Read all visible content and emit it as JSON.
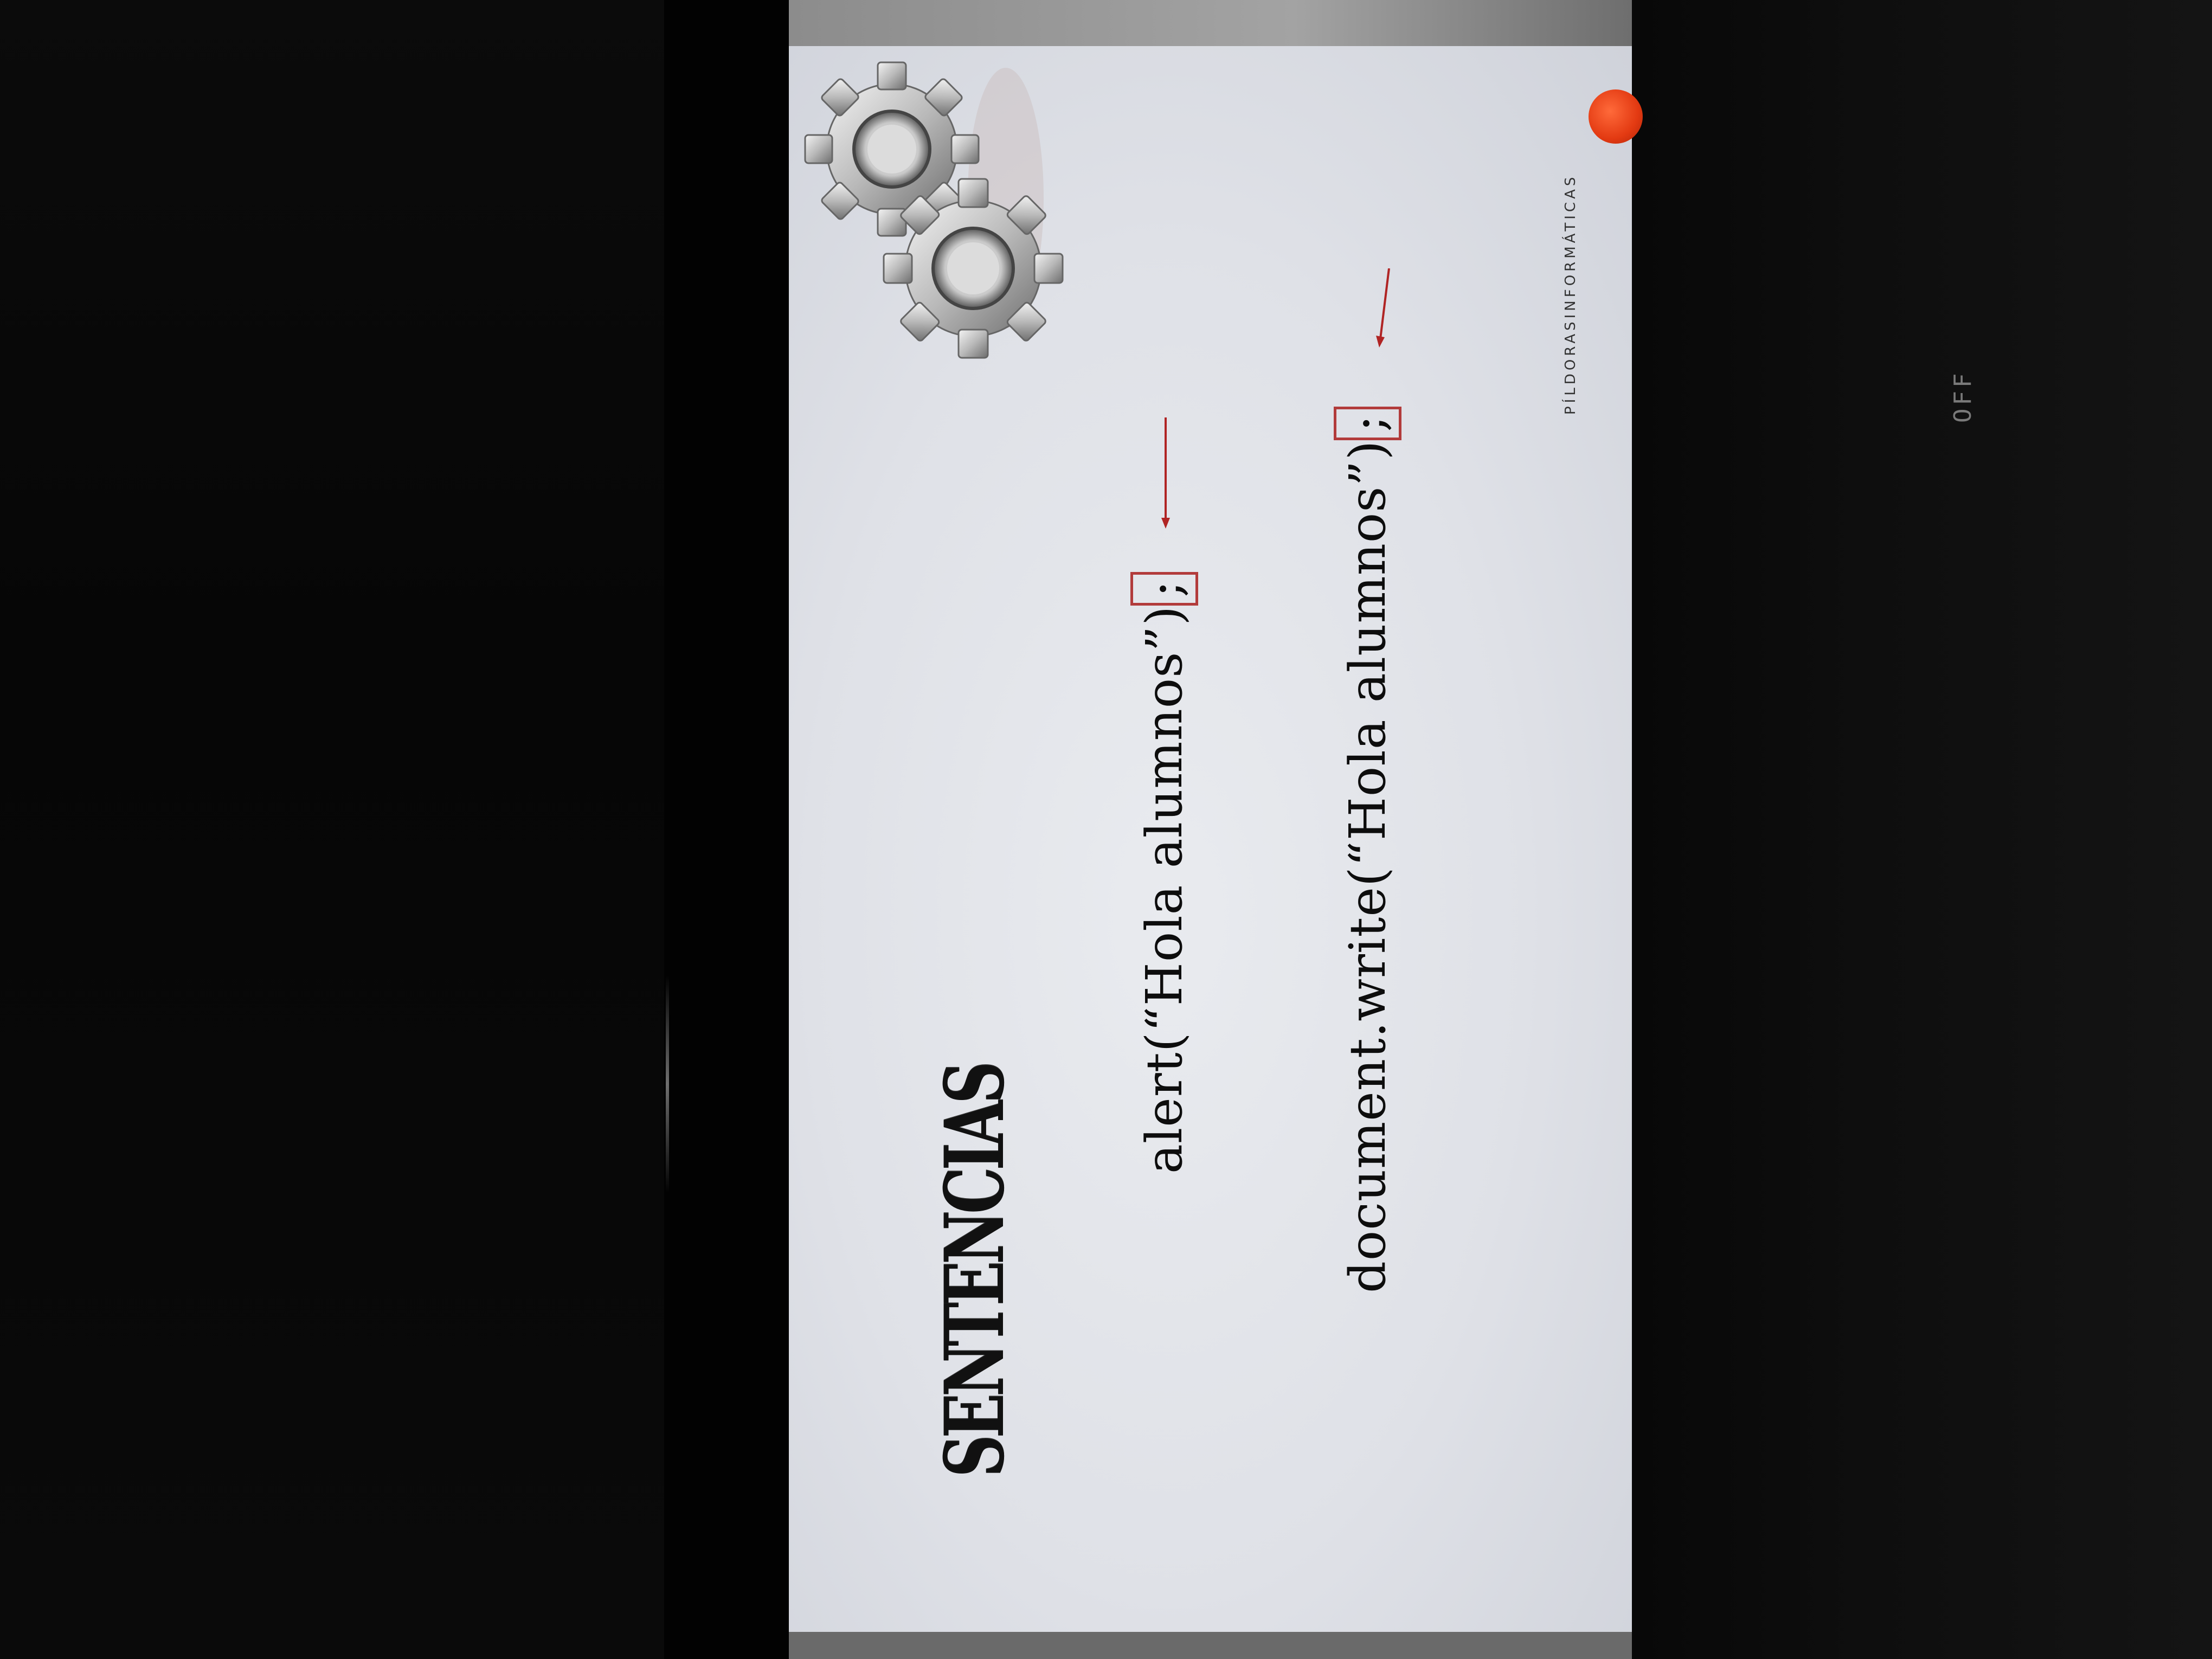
{
  "slide": {
    "title": "SENTENCIAS",
    "code_lines": [
      {
        "code": "alert(“Hola alumnos”)",
        "terminator": ";"
      },
      {
        "code": "document.write(“Hola alumnos”)",
        "terminator": ";"
      }
    ],
    "footer_brand": "PÍLDORASINFORMÁTICAS"
  },
  "device": {
    "status_label": "OFF"
  },
  "icons": [
    "gears-icon",
    "logo-dot-icon",
    "arrow-icon"
  ],
  "colors": {
    "highlight": "#b23b3b",
    "logo": "#e33a12",
    "slide_bg": "#e2e4ea"
  }
}
